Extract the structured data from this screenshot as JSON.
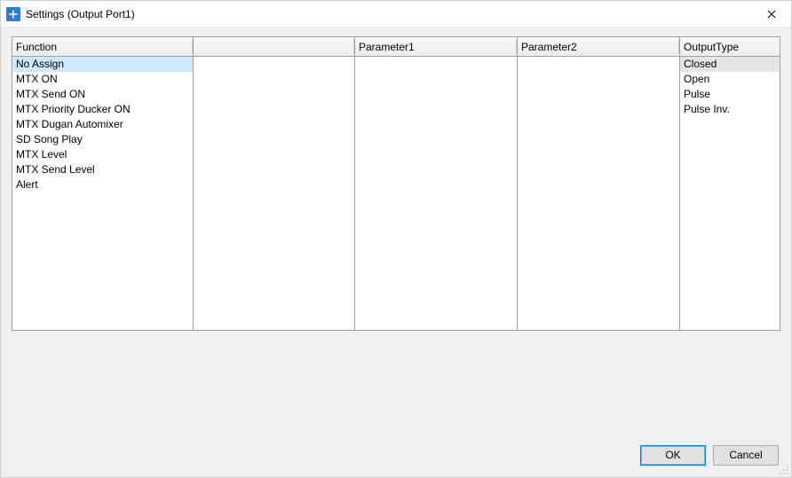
{
  "window": {
    "title": "Settings (Output Port1)"
  },
  "columns": {
    "function": {
      "header": "Function"
    },
    "blank": {
      "header": ""
    },
    "parameter1": {
      "header": "Parameter1"
    },
    "parameter2": {
      "header": "Parameter2"
    },
    "outputtype": {
      "header": "OutputType"
    }
  },
  "function_items": [
    "No Assign",
    "MTX ON",
    "MTX Send ON",
    "MTX Priority Ducker ON",
    "MTX Dugan Automixer",
    "SD Song Play",
    "MTX Level",
    "MTX Send Level",
    "Alert"
  ],
  "function_selected_index": 0,
  "outputtype_items": [
    "Closed",
    "Open",
    "Pulse",
    "Pulse Inv."
  ],
  "outputtype_selected_index": 0,
  "buttons": {
    "ok": "OK",
    "cancel": "Cancel"
  }
}
